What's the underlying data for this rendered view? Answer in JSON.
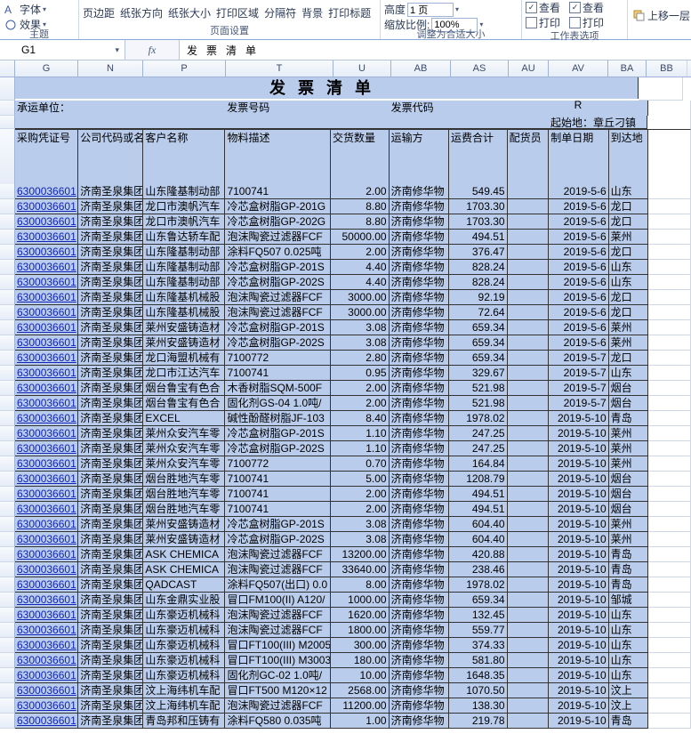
{
  "ribbon": {
    "group_theme": {
      "items": [
        "字体",
        "效果"
      ],
      "label": "主题"
    },
    "group_page": {
      "items": [
        "页边距",
        "纸张方向",
        "纸张大小",
        "打印区域",
        "分隔符",
        "背景",
        "打印标题"
      ],
      "label": "页面设置"
    },
    "group_scale": {
      "height_lbl": "高度",
      "height_val": "1 页",
      "ratio_lbl": "缩放比例:",
      "ratio_val": "100%",
      "label": "调整为合适大小"
    },
    "group_sheet": {
      "cb1": "查看",
      "cb2": "打印",
      "cb3": "查看",
      "cb4": "打印",
      "label": "工作表选项"
    },
    "group_arrange": {
      "item": "上移一层",
      "label": ""
    }
  },
  "fxbar": {
    "name": "G1",
    "fx": "fx",
    "value": "发票清单"
  },
  "columns_letters": [
    "G",
    "N",
    "P",
    "T",
    "U",
    "AB",
    "AS",
    "AU",
    "AV",
    "BA",
    "BB"
  ],
  "title": "发票清单",
  "meta_row": {
    "carrier_label": "承运单位：",
    "invoice_no_label": "发票号码",
    "invoice_code_label": "发票代码",
    "r_mark": "R",
    "origin_label": "起始地：章丘刁镇"
  },
  "headers": [
    "采购凭证号",
    "公司代码或名",
    "客户名称",
    "物料描述",
    "交货数量",
    "运输方",
    "运费合计",
    "配货员",
    "制单日期",
    "到达地"
  ],
  "rows": [
    [
      "6300036601",
      "济南圣泉集团",
      "山东隆基制动部",
      "7100741",
      "2.00",
      "济南修华物",
      "549.45",
      "",
      "2019-5-6",
      "山东"
    ],
    [
      "6300036601",
      "济南圣泉集团",
      "龙口市澳帆汽车",
      "冷芯盒树脂GP-201G",
      "8.80",
      "济南修华物",
      "1703.30",
      "",
      "2019-5-6",
      "龙口"
    ],
    [
      "6300036601",
      "济南圣泉集团",
      "龙口市澳帆汽车",
      "冷芯盒树脂GP-202G",
      "8.80",
      "济南修华物",
      "1703.30",
      "",
      "2019-5-6",
      "龙口"
    ],
    [
      "6300036601",
      "济南圣泉集团",
      "山东鲁达轿车配",
      "泡沫陶瓷过滤器FCF",
      "50000.00",
      "济南修华物",
      "494.51",
      "",
      "2019-5-6",
      "莱州"
    ],
    [
      "6300036601",
      "济南圣泉集团",
      "山东隆基制动部",
      "涂料FQ507 0.025吨",
      "2.00",
      "济南修华物",
      "376.47",
      "",
      "2019-5-6",
      "龙口"
    ],
    [
      "6300036601",
      "济南圣泉集团",
      "山东隆基制动部",
      "冷芯盒树脂GP-201S",
      "4.40",
      "济南修华物",
      "828.24",
      "",
      "2019-5-6",
      "山东"
    ],
    [
      "6300036601",
      "济南圣泉集团",
      "山东隆基制动部",
      "冷芯盒树脂GP-202S",
      "4.40",
      "济南修华物",
      "828.24",
      "",
      "2019-5-6",
      "山东"
    ],
    [
      "6300036601",
      "济南圣泉集团",
      "山东隆基机械股",
      "泡沫陶瓷过滤器FCF",
      "3000.00",
      "济南修华物",
      "92.19",
      "",
      "2019-5-6",
      "龙口"
    ],
    [
      "6300036601",
      "济南圣泉集团",
      "山东隆基机械股",
      "泡沫陶瓷过滤器FCF",
      "3000.00",
      "济南修华物",
      "72.64",
      "",
      "2019-5-6",
      "龙口"
    ],
    [
      "6300036601",
      "济南圣泉集团",
      "莱州安盛铸造材",
      "冷芯盒树脂GP-201S",
      "3.08",
      "济南修华物",
      "659.34",
      "",
      "2019-5-6",
      "莱州"
    ],
    [
      "6300036601",
      "济南圣泉集团",
      "莱州安盛铸造材",
      "冷芯盒树脂GP-202S",
      "3.08",
      "济南修华物",
      "659.34",
      "",
      "2019-5-6",
      "莱州"
    ],
    [
      "6300036601",
      "济南圣泉集团",
      "龙口海盟机械有",
      "7100772",
      "2.80",
      "济南修华物",
      "659.34",
      "",
      "2019-5-7",
      "龙口"
    ],
    [
      "6300036601",
      "济南圣泉集团",
      "龙口市江达汽车",
      "7100741",
      "0.95",
      "济南修华物",
      "329.67",
      "",
      "2019-5-7",
      "山东"
    ],
    [
      "6300036601",
      "济南圣泉集团",
      "烟台鲁宝有色合",
      "木香树脂SQM-500F",
      "2.00",
      "济南修华物",
      "521.98",
      "",
      "2019-5-7",
      "烟台"
    ],
    [
      "6300036601",
      "济南圣泉集团",
      "烟台鲁宝有色合",
      "固化剂GS-04 1.0吨/",
      "2.00",
      "济南修华物",
      "521.98",
      "",
      "2019-5-7",
      "烟台"
    ],
    [
      "6300036601",
      "济南圣泉集团",
      "EXCEL",
      "碱性酚醛树脂JF-103",
      "8.40",
      "济南修华物",
      "1978.02",
      "",
      "2019-5-10",
      "青岛"
    ],
    [
      "6300036601",
      "济南圣泉集团",
      "莱州众安汽车零",
      "冷芯盒树脂GP-201S",
      "1.10",
      "济南修华物",
      "247.25",
      "",
      "2019-5-10",
      "莱州"
    ],
    [
      "6300036601",
      "济南圣泉集团",
      "莱州众安汽车零",
      "冷芯盒树脂GP-202S",
      "1.10",
      "济南修华物",
      "247.25",
      "",
      "2019-5-10",
      "莱州"
    ],
    [
      "6300036601",
      "济南圣泉集团",
      "莱州众安汽车零",
      "7100772",
      "0.70",
      "济南修华物",
      "164.84",
      "",
      "2019-5-10",
      "莱州"
    ],
    [
      "6300036601",
      "济南圣泉集团",
      "烟台胜地汽车零",
      "7100741",
      "5.00",
      "济南修华物",
      "1208.79",
      "",
      "2019-5-10",
      "烟台"
    ],
    [
      "6300036601",
      "济南圣泉集团",
      "烟台胜地汽车零",
      "7100741",
      "2.00",
      "济南修华物",
      "494.51",
      "",
      "2019-5-10",
      "烟台"
    ],
    [
      "6300036601",
      "济南圣泉集团",
      "烟台胜地汽车零",
      "7100741",
      "2.00",
      "济南修华物",
      "494.51",
      "",
      "2019-5-10",
      "烟台"
    ],
    [
      "6300036601",
      "济南圣泉集团",
      "莱州安盛铸造材",
      "冷芯盒树脂GP-201S",
      "3.08",
      "济南修华物",
      "604.40",
      "",
      "2019-5-10",
      "莱州"
    ],
    [
      "6300036601",
      "济南圣泉集团",
      "莱州安盛铸造材",
      "冷芯盒树脂GP-202S",
      "3.08",
      "济南修华物",
      "604.40",
      "",
      "2019-5-10",
      "莱州"
    ],
    [
      "6300036601",
      "济南圣泉集团",
      "ASK CHEMICA",
      "泡沫陶瓷过滤器FCF",
      "13200.00",
      "济南修华物",
      "420.88",
      "",
      "2019-5-10",
      "青岛"
    ],
    [
      "6300036601",
      "济南圣泉集团",
      "ASK CHEMICA",
      "泡沫陶瓷过滤器FCF",
      "33640.00",
      "济南修华物",
      "238.46",
      "",
      "2019-5-10",
      "青岛"
    ],
    [
      "6300036601",
      "济南圣泉集团",
      "QADCAST",
      "涂料FQ507(出口) 0.0",
      "8.00",
      "济南修华物",
      "1978.02",
      "",
      "2019-5-10",
      "青岛"
    ],
    [
      "6300036601",
      "济南圣泉集团",
      "山东金鼎实业股",
      "冒口FM100(II) A120/",
      "1000.00",
      "济南修华物",
      "659.34",
      "",
      "2019-5-10",
      "邹城"
    ],
    [
      "6300036601",
      "济南圣泉集团",
      "山东豪迈机械科",
      "泡沫陶瓷过滤器FCF",
      "1620.00",
      "济南修华物",
      "132.45",
      "",
      "2019-5-10",
      "山东"
    ],
    [
      "6300036601",
      "济南圣泉集团",
      "山东豪迈机械科",
      "泡沫陶瓷过滤器FCF",
      "1800.00",
      "济南修华物",
      "559.77",
      "",
      "2019-5-10",
      "山东"
    ],
    [
      "6300036601",
      "济南圣泉集团",
      "山东豪迈机械科",
      "冒口FT100(III) M2005",
      "300.00",
      "济南修华物",
      "374.33",
      "",
      "2019-5-10",
      "山东"
    ],
    [
      "6300036601",
      "济南圣泉集团",
      "山东豪迈机械科",
      "冒口FT100(III) M3003",
      "180.00",
      "济南修华物",
      "581.80",
      "",
      "2019-5-10",
      "山东"
    ],
    [
      "6300036601",
      "济南圣泉集团",
      "山东豪迈机械科",
      "固化剂GC-02 1.0吨/",
      "10.00",
      "济南修华物",
      "1648.35",
      "",
      "2019-5-10",
      "山东"
    ],
    [
      "6300036601",
      "济南圣泉集团",
      "汶上海纬机车配",
      "冒口FT500 M120×12",
      "2568.00",
      "济南修华物",
      "1070.50",
      "",
      "2019-5-10",
      "汶上"
    ],
    [
      "6300036601",
      "济南圣泉集团",
      "汶上海纬机车配",
      "泡沫陶瓷过滤器FCF",
      "11200.00",
      "济南修华物",
      "138.30",
      "",
      "2019-5-10",
      "汶上"
    ],
    [
      "6300036601",
      "济南圣泉集团",
      "青岛邦和压铸有",
      "涂料FQ580 0.035吨",
      "1.00",
      "济南修华物",
      "219.78",
      "",
      "2019-5-10",
      "青岛"
    ]
  ]
}
